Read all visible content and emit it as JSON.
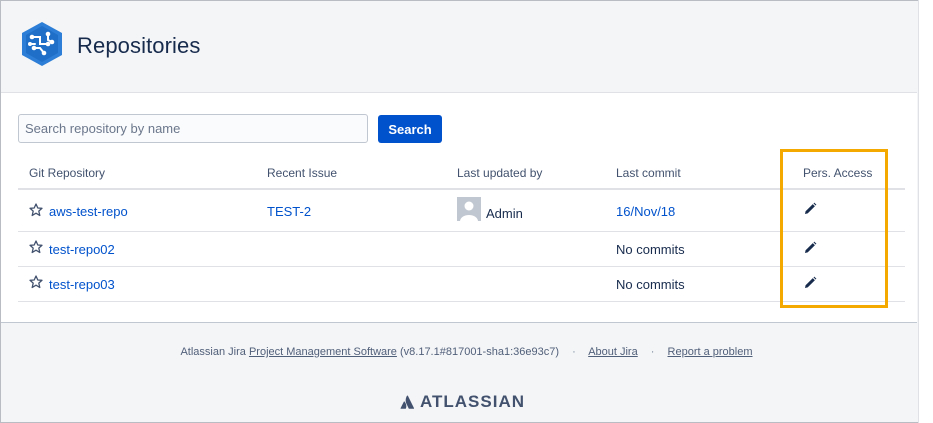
{
  "header": {
    "title": "Repositories"
  },
  "search": {
    "placeholder": "Search repository by name",
    "value": "",
    "button_label": "Search"
  },
  "table": {
    "columns": [
      "Git Repository",
      "Recent Issue",
      "Last updated by",
      "Last commit",
      "Pers. Access"
    ],
    "rows": [
      {
        "repository": "aws-test-repo",
        "recent_issue": "TEST-2",
        "updated_by": "Admin",
        "last_commit": "16/Nov/18"
      },
      {
        "repository": "test-repo02",
        "recent_issue": "",
        "updated_by": "",
        "last_commit": "No commits"
      },
      {
        "repository": "test-repo03",
        "recent_issue": "",
        "updated_by": "",
        "last_commit": "No commits"
      }
    ]
  },
  "footer": {
    "prefix": "Atlassian Jira",
    "product_link": "Project Management Software",
    "version": "(v8.17.1#817001-sha1:36e93c7)",
    "about_link": "About Jira",
    "report_link": "Report a problem",
    "separator": "·",
    "brand": "ATLASSIAN"
  },
  "icons": {
    "app_logo": "repository-logo-icon",
    "favorite": "star-icon",
    "edit": "pencil-icon",
    "user": "avatar-icon",
    "brand": "atlassian-logo-icon"
  },
  "colors": {
    "primary": "#0052cc",
    "highlight": "#f4a900",
    "logo": "#2d7ed6"
  }
}
